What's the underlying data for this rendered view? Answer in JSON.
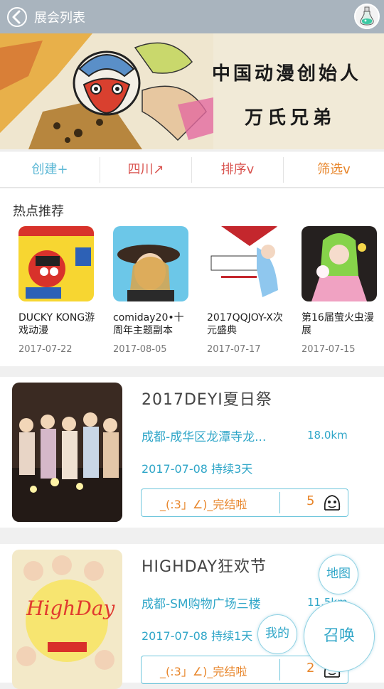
{
  "header": {
    "title": "展会列表",
    "back_icon": "chevron-left-icon",
    "avatar_icon": "potion-bottle-icon"
  },
  "banner": {
    "line1": "中国动漫创始人",
    "line2": "万氏兄弟"
  },
  "filters": [
    {
      "label": "创建+",
      "color": "#5fb9d6"
    },
    {
      "label": "四川↗",
      "color": "#d9534f"
    },
    {
      "label": "排序v",
      "color": "#d9534f"
    },
    {
      "label": "筛选v",
      "color": "#e8862b"
    }
  ],
  "hot": {
    "title": "热点推荐",
    "items": [
      {
        "name": "DUCKY KONG游戏动漫",
        "date": "2017-07-22"
      },
      {
        "name": "comiday20•十周年主题副本",
        "date": "2017-08-05"
      },
      {
        "name": "2017QQJOY-X次元盛典",
        "date": "2017-07-17"
      },
      {
        "name": "第16届萤火虫漫展",
        "date": "2017-07-15"
      }
    ]
  },
  "events": [
    {
      "title": "2017DEYI夏日祭",
      "location": "成都-成华区龙潭寺龙...",
      "distance": "18.0km",
      "date": "2017-07-08 持续3天",
      "status": "_(:3」∠)_完结啦",
      "count": "5"
    },
    {
      "title": "HIGHDAY狂欢节",
      "location": "成都-SM购物广场三楼",
      "distance": "11.5km",
      "date": "2017-07-08 持续1天",
      "status": "_(:3」∠)_完结啦",
      "count": "2"
    }
  ],
  "fabs": {
    "map": "地图",
    "mine": "我的",
    "summon": "召唤"
  },
  "colors": {
    "accent": "#2fa6c8",
    "orange": "#e8862b",
    "red": "#d9534f",
    "topbar": "#a9b4be"
  }
}
